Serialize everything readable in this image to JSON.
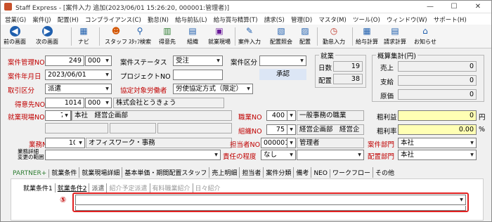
{
  "window": {
    "title": "Staff Express - [案件入力 追加(2023/06/01 15:26:20, 000001:管理者)]",
    "minimize": "—",
    "maximize": "☐",
    "close": "✕"
  },
  "menu": [
    "営業(G)",
    "案件(J)",
    "配置(H)",
    "コンプライアンス(C)",
    "勤怠(N)",
    "給与前払(L)",
    "給与賞与精算(T)",
    "請求(S)",
    "管理(D)",
    "マスタ(M)",
    "ツール(O)",
    "ウィンドウ(W)",
    "サポート(H)"
  ],
  "toolbar": {
    "prev": "前の画面",
    "next": "次の画面",
    "navi": "ナビ",
    "staff": "スタッフ",
    "staff_search": "ｽﾀｯﾌ検索",
    "client": "得意先",
    "org": "組織",
    "site": "就業現場",
    "job_entry": "案件入力",
    "assign_query": "配置照会",
    "assign": "配置",
    "attendance_entry": "勤怠入力",
    "payroll_calc": "給与計算",
    "billing_calc": "請求計算",
    "notice": "お知らせ"
  },
  "form": {
    "job_no_label": "案件管理NO",
    "job_no": "249",
    "job_no_branch": "000",
    "status_label": "案件ステータス",
    "status": "受注",
    "category_label": "案件区分",
    "category": "",
    "date_label": "案件年月日",
    "date": "2023/06/01",
    "project_label": "プロジェクトNO",
    "project": "",
    "approve": "承認",
    "trade_label": "取引区分",
    "trade": "派遣",
    "agreement_label": "協定対象労働者",
    "agreement": "労使協定方式（限定）",
    "client_label": "得意先NO",
    "client_no": "1014",
    "client_branch": "000",
    "client_name": "株式会社とうきょう",
    "site_label": "就業現場NO",
    "site_no": "75",
    "site_name": "本社　経営企画部",
    "site_sub1": "",
    "site_sub2": "",
    "site_sub3": "",
    "jobtype_label": "職業NO",
    "jobtype_no": "400",
    "jobtype_name": "一般事務の職業",
    "org_label": "組織NO",
    "org_no": "75",
    "org_name": "経営企画部　経営企",
    "work_label": "業務NO",
    "work_no": "100",
    "work_name": "オフィスワーク・事務",
    "staff_label": "担当者NO",
    "staff_no": "000001",
    "staff_name": "管理者",
    "detail_label_1": "業務詳細",
    "detail_label_2": "変更の範囲",
    "responsibility_label": "責任の程度",
    "responsibility": "なし",
    "job_dept_label": "案件部門",
    "job_dept": "本社",
    "assign_dept_label": "配置部門",
    "assign_dept": "本社"
  },
  "work_summary": {
    "title": "就業",
    "days_label": "日数",
    "days": "19",
    "assigned_label": "配置",
    "assigned": "38"
  },
  "estimate": {
    "title": "概算集計(円)",
    "sales_label": "売上",
    "sales": "0",
    "pay_label": "支給",
    "pay": "0",
    "cost_label": "原価",
    "cost": "0",
    "gross_label": "粗利益",
    "gross": "0",
    "gross_unit": "円",
    "rate_label": "粗利率",
    "rate": "0.00",
    "rate_unit": "%"
  },
  "tabs": [
    "PARTNER+",
    "就業条件",
    "就業現場詳細",
    "基本単価・期間配置スタッフ",
    "売上明細",
    "担当者",
    "案件分類",
    "備考",
    "NEO",
    "ワークフロー",
    "その他"
  ],
  "subtabs": [
    "就業条件1",
    "就業条件2",
    "派遣",
    "紹介予定派遣",
    "有料職業紹介",
    "日々紹介"
  ],
  "annotation": "⑤",
  "panel_field": ""
}
